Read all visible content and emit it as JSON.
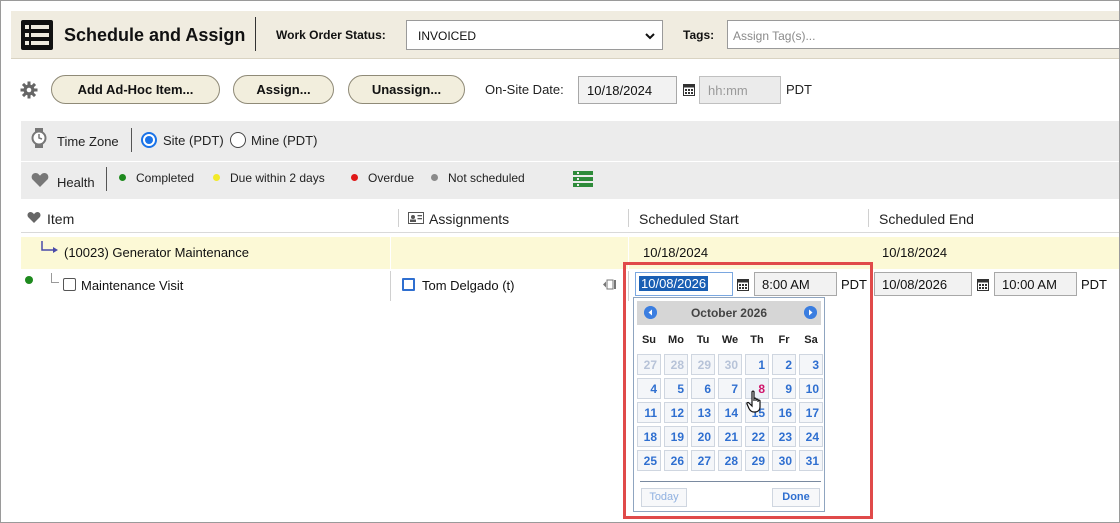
{
  "header": {
    "title": "Schedule and Assign",
    "work_order_status_label": "Work Order Status:",
    "work_order_status_value": "INVOICED",
    "tags_label": "Tags:",
    "tags_placeholder": "Assign Tag(s)..."
  },
  "toolbar": {
    "add_adhoc_label": "Add Ad-Hoc Item...",
    "assign_label": "Assign...",
    "unassign_label": "Unassign...",
    "onsite_label": "On-Site Date:",
    "onsite_date": "10/18/2024",
    "onsite_time_placeholder": "hh:mm",
    "onsite_tz": "PDT"
  },
  "timezone": {
    "label": "Time Zone",
    "site_label": "Site (PDT)",
    "mine_label": "Mine (PDT)",
    "selected": "site"
  },
  "health": {
    "label": "Health",
    "legend": [
      {
        "label": "Completed",
        "color": "#1e8a1e"
      },
      {
        "label": "Due within 2 days",
        "color": "#f2ea28"
      },
      {
        "label": "Overdue",
        "color": "#e01818"
      },
      {
        "label": "Not scheduled",
        "color": "#8a8a8a"
      }
    ]
  },
  "grid": {
    "columns": {
      "item": "Item",
      "assignments": "Assignments",
      "scheduled_start": "Scheduled Start",
      "scheduled_end": "Scheduled End"
    },
    "rows": [
      {
        "item": "(10023) Generator Maintenance",
        "start": "10/18/2024",
        "end": "10/18/2024"
      },
      {
        "item": "Maintenance Visit",
        "assignee": "Tom Delgado (t)",
        "start_date": "10/08/2026",
        "start_time": "8:00 AM",
        "start_tz": "PDT",
        "end_date": "10/08/2026",
        "end_time": "10:00 AM",
        "end_tz": "PDT"
      }
    ]
  },
  "datepicker": {
    "month_title": "October 2026",
    "weekdays": [
      "Su",
      "Mo",
      "Tu",
      "We",
      "Th",
      "Fr",
      "Sa"
    ],
    "days": [
      [
        "27",
        "28",
        "29",
        "30",
        "1",
        "2",
        "3"
      ],
      [
        "4",
        "5",
        "6",
        "7",
        "8",
        "9",
        "10"
      ],
      [
        "11",
        "12",
        "13",
        "14",
        "15",
        "16",
        "17"
      ],
      [
        "18",
        "19",
        "20",
        "21",
        "22",
        "23",
        "24"
      ],
      [
        "25",
        "26",
        "27",
        "28",
        "29",
        "30",
        "31"
      ]
    ],
    "other_month_cells": 4,
    "selected_day": "8",
    "today_label": "Today",
    "done_label": "Done"
  },
  "colors": {
    "header_bg": "#f0ece0",
    "button_bg": "#f2eedd",
    "accent_blue": "#1a73e8",
    "highlight_red": "#e04a4a",
    "row_highlight": "#fcf9d6",
    "today_pink": "#d0146a"
  }
}
